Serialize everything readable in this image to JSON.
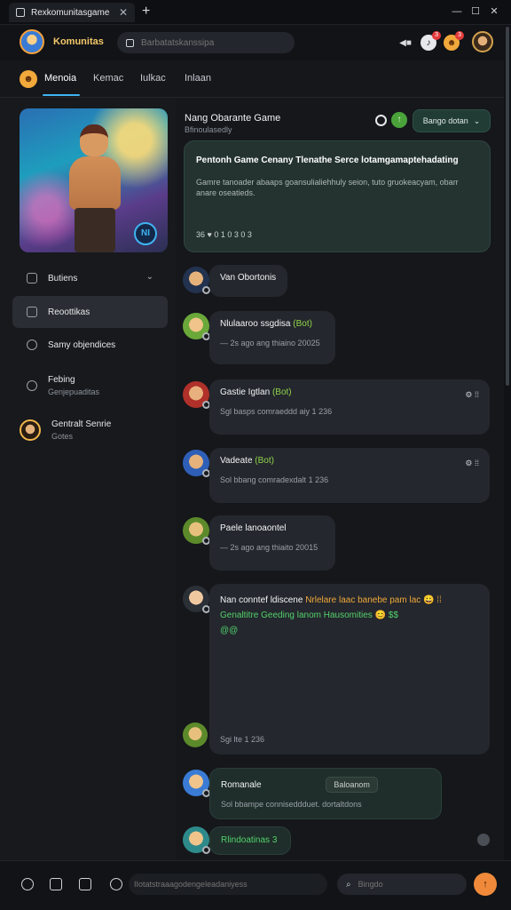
{
  "window": {
    "tab_title": "Rexkomunitasgame",
    "new_tab": "+",
    "controls": [
      "—",
      "☐",
      "✕"
    ]
  },
  "header": {
    "brand": "Komunitas",
    "search_placeholder": "Barbatatskanssipa",
    "notification_count_1": "3",
    "notification_count_2": "3"
  },
  "nav": {
    "tabs": [
      "Menoia",
      "Kemac",
      "Iulkac",
      "Inlaan"
    ]
  },
  "sidebar": {
    "hero_badge": "NI",
    "items": [
      {
        "label": "Butiens",
        "sub": ""
      },
      {
        "label": "Reoottikas",
        "sub": ""
      },
      {
        "label": "Samy objendices",
        "sub": ""
      },
      {
        "label": "Febing",
        "sub": "Genjepuaditas"
      },
      {
        "label": "Gentralt Senrie",
        "sub": "Gotes"
      }
    ]
  },
  "feed": {
    "head_title": "Nang Obarante Game",
    "head_sub": "Bfinoulasedly",
    "dropdown_label": "Bango dotan",
    "feature": {
      "title": "Pentonh Game Cenany Tlenathe Serce lotamgamaptehadating",
      "body": "Gamre tanoader abaaps goansulialiehhuly seion, tuto gruokeacyam, obarr anare oseatieds.",
      "meta": "36 ♥  0 1 0 3 0 3"
    },
    "posts": [
      {
        "title": "Van Obortonis",
        "tag": "",
        "meta": "",
        "icons": ""
      },
      {
        "title": "Nlulaaroo ssgdisa",
        "tag": "(Bot)",
        "meta": "— 2s ago ang thiaino 20025",
        "icons": ""
      },
      {
        "title": "Gastie Igtlan",
        "tag": "(Bot)",
        "meta": "Sgl basps comraeddd aiy 1 236",
        "icons": "⚙ ⁞⁞"
      },
      {
        "title": "Vadeate",
        "tag": "(Bot)",
        "meta": "Sol bbang comradexdalt 1 236",
        "icons": "⚙ ⁞⁞"
      },
      {
        "title": "Paele lanoaontel",
        "tag": "",
        "meta": "— 2s ago ang thiaito 20015",
        "icons": ""
      },
      {
        "line1_a": "Nan conntef ldiscene",
        "line1_b": "Nrlelare laac banebe pam",
        "line1_c": "lac 😀 ⁞⁞",
        "line2_a": "Genaltitre",
        "line2_b": "Geeding lanom Hausomities 😊 $$",
        "line3": "@@",
        "meta": "Sgi lte 1 236"
      },
      {
        "title": "Romanale",
        "chip": "Baloanom",
        "meta": "Sol bbampe conniseddduet. dortaltdons"
      },
      {
        "title": "Rlindoatinas 3"
      }
    ]
  },
  "composer": {
    "input_placeholder": "IIotatstraaagodengeleadaniyess",
    "search_placeholder": "Bingdo",
    "send_icon": "↑"
  },
  "colors": {
    "accent": "#3fb4f0",
    "brand": "#f5c96a",
    "bot_tag": "#8fd34b",
    "send": "#f08a3a"
  }
}
